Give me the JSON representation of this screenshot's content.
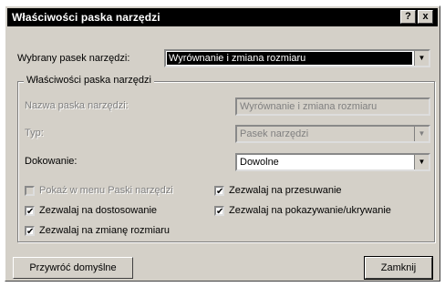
{
  "window": {
    "title": "Właściwości paska narzędzi",
    "help_glyph": "?",
    "close_glyph": "x"
  },
  "selected_toolbar": {
    "label": "Wybrany pasek narzędzi:",
    "value": "Wyrównanie i zmiana rozmiaru"
  },
  "group": {
    "title": "Właściwości paska narzędzi",
    "name_label": "Nazwa paska narzędzi:",
    "name_value": "Wyrównanie i zmiana rozmiaru",
    "type_label": "Typ:",
    "type_value": "Pasek narzędzi",
    "docking_label": "Dokowanie:",
    "docking_value": "Dowolne"
  },
  "options": {
    "show_in_menu": {
      "label": "Pokaż w menu Paski narzędzi",
      "checked": false,
      "enabled": false
    },
    "allow_customize": {
      "label": "Zezwalaj na dostosowanie",
      "checked": true,
      "enabled": true
    },
    "allow_resize": {
      "label": "Zezwalaj na zmianę rozmiaru",
      "checked": true,
      "enabled": true
    },
    "allow_move": {
      "label": "Zezwalaj na przesuwanie",
      "checked": true,
      "enabled": true
    },
    "allow_show_hide": {
      "label": "Zezwalaj na pokazywanie/ukrywanie",
      "checked": true,
      "enabled": true
    }
  },
  "buttons": {
    "restore_defaults": "Przywróć domyślne",
    "close": "Zamknij"
  },
  "glyphs": {
    "check": "✔",
    "dropdown_arrow": "▼"
  }
}
